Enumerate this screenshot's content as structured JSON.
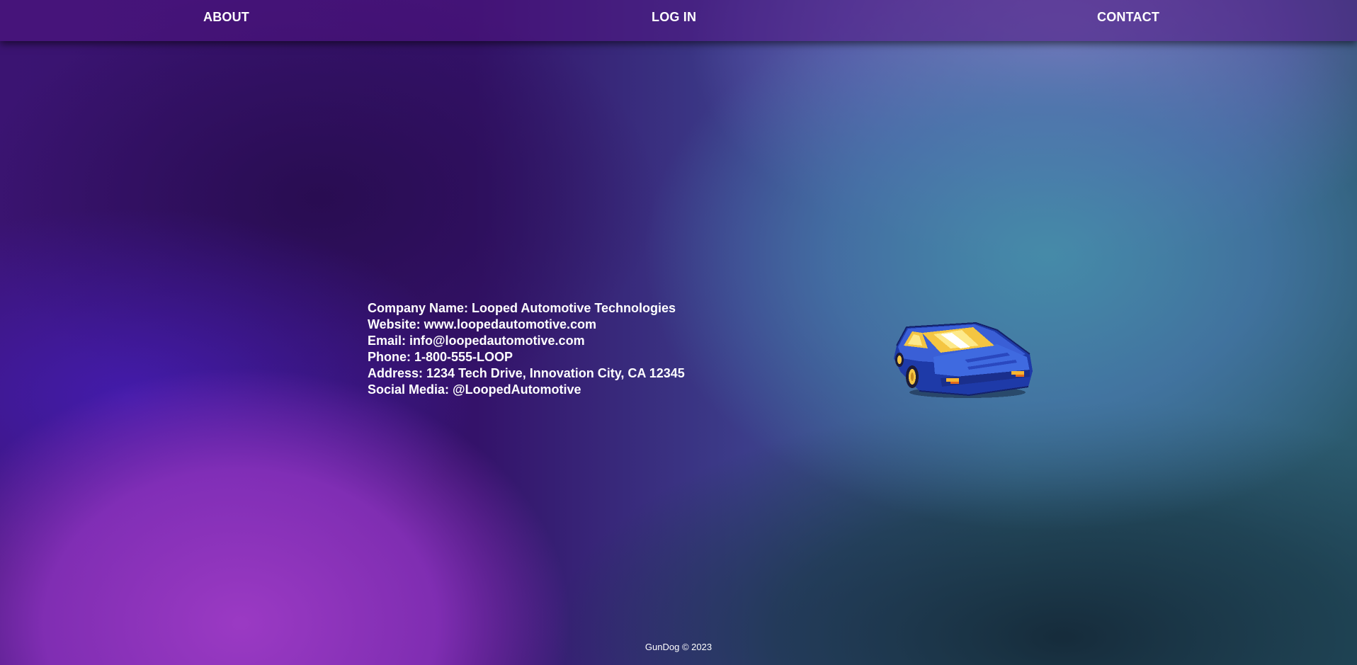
{
  "nav": {
    "about_label": "ABOUT",
    "login_label": "LOG IN",
    "contact_label": "CONTACT"
  },
  "contact": {
    "company": "Company Name: Looped Automotive Technologies",
    "website": "Website: www.loopedautomotive.com",
    "email": "Email: info@loopedautomotive.com",
    "phone": "Phone: 1-800-555-LOOP",
    "address": "Address: 1234 Tech Drive, Innovation City, CA 12345",
    "social": "Social Media: @LoopedAutomotive"
  },
  "image": {
    "icon": "pixel-sports-car-icon",
    "body_color": "#3a5fd6",
    "window_color": "#f4c542"
  },
  "footer": {
    "text": "GunDog © 2023"
  },
  "colors": {
    "text": "#ffffff",
    "nav_bg": "#501482"
  }
}
